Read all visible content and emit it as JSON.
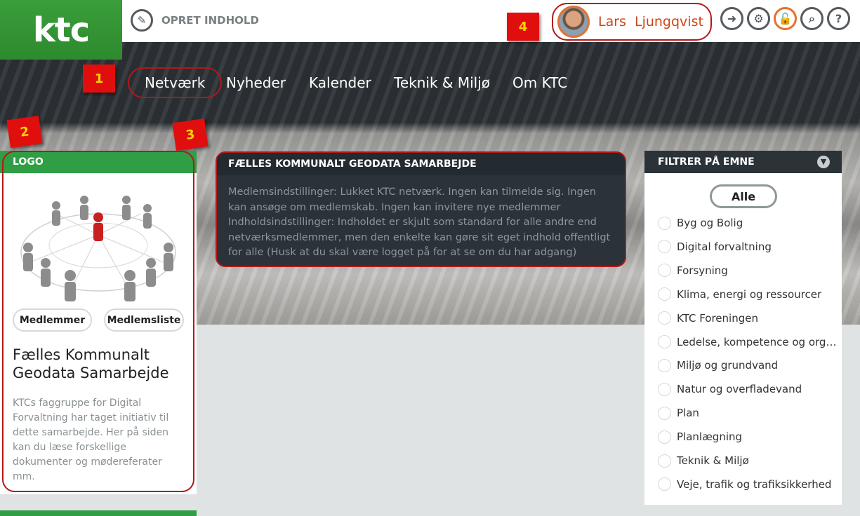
{
  "header": {
    "logo_text": "ktc",
    "create_label": "OPRET INDHOLD",
    "user_name": "Lars  Ljungqvist",
    "tools": [
      "arrow-icon",
      "gear-icon",
      "lock-icon",
      "search-icon",
      "help-icon"
    ]
  },
  "nav": {
    "items": [
      {
        "label": "Netværk"
      },
      {
        "label": "Nyheder"
      },
      {
        "label": "Kalender"
      },
      {
        "label": "Teknik & Miljø"
      },
      {
        "label": "Om KTC"
      }
    ]
  },
  "callouts": [
    "1",
    "2",
    "3",
    "4"
  ],
  "card": {
    "header": "LOGO",
    "buttons": [
      "Medlemmer",
      "Medlemsliste"
    ],
    "title": "Fælles Kommunalt Geodata Samarbejde",
    "description": "KTCs faggruppe for Digital Forvaltning har taget initiativ til dette samarbejde. Her på siden kan du læse forskellige dokumenter og mødereferater mm."
  },
  "info": {
    "header": "FÆLLES KOMMUNALT GEODATA SAMARBEJDE",
    "body": "Medlemsindstillinger: Lukket KTC netværk. Ingen kan tilmelde sig. Ingen kan ansøge om medlemskab. Ingen kan invitere nye medlemmer Indholdsindstillinger: Indholdet er skjult som standard for alle andre end netværksmedlemmer, men den enkelte kan gøre sit eget indhold offentligt for alle (Husk at du skal være logget på for at se om du har adgang)"
  },
  "filter": {
    "header": "FILTRER PÅ EMNE",
    "all_label": "Alle",
    "topics": [
      "Byg og Bolig",
      "Digital forvaltning",
      "Forsyning",
      "Klima, energi og ressourcer",
      "KTC Foreningen",
      "Ledelse, kompetence og organisation",
      "Miljø og grundvand",
      "Natur og overfladevand",
      "Plan",
      "Planlægning",
      "Teknik & Miljø",
      "Veje, trafik og trafiksikkerhed"
    ]
  },
  "colors": {
    "brand_green": "#2f9e44",
    "dark": "#2b3339",
    "accent_orange": "#e8702a",
    "highlight_red": "#b31818"
  }
}
